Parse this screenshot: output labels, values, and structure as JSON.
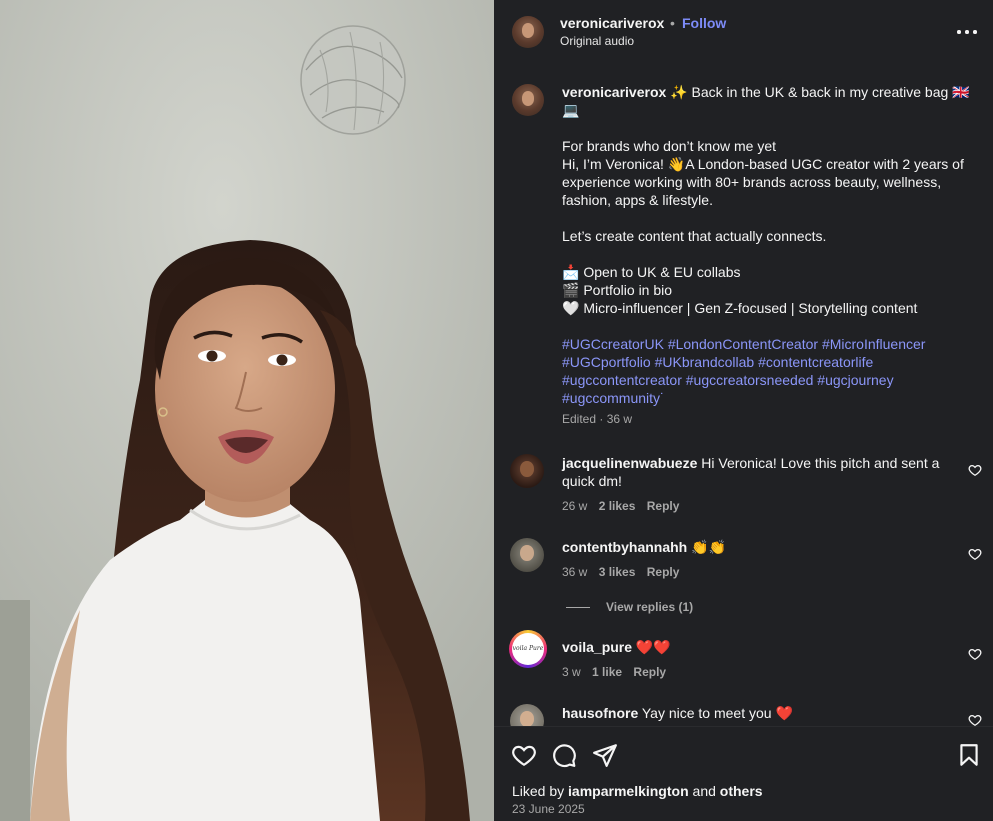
{
  "post": {
    "username": "veronicariverox",
    "dot": "•",
    "follow_label": "Follow",
    "audio": "Original audio"
  },
  "caption": {
    "username": "veronicariverox",
    "line1": " ✨ Back in the UK & back in my creative bag 🇬🇧💻",
    "line2": "For brands who don’t know me yet",
    "line3": "Hi, I’m Veronica! 👋A London-based UGC creator with 2 years of experience working with 80+ brands across beauty, wellness, fashion, apps & lifestyle.",
    "line4": "Let’s create content that actually connects.",
    "line5": "📩 Open to UK & EU collabs",
    "line6": "🎬 Portfolio in bio",
    "line7": "🤍 Micro-influencer | Gen Z-focused | Storytelling content",
    "hashtags": [
      "#UGCcreatorUK",
      "#LondonContentCreator",
      "#MicroInfluencer",
      "#UGCportfolio",
      "#UKbrandcollab",
      "#contentcreatorlife",
      "#ugccontentcreator",
      "#ugccreatorsneeded",
      "#ugcjourney",
      "#ugccommunity"
    ],
    "hashtag_suffix": "˙",
    "meta": "Edited · 36 w"
  },
  "comments": [
    {
      "username": "jacquelinenwabueze",
      "text": " Hi Veronica! Love this pitch and sent a quick dm!",
      "age": "26 w",
      "likes": "2 likes",
      "reply": "Reply"
    },
    {
      "username": "contentbyhannahh",
      "text": " 👏👏",
      "age": "36 w",
      "likes": "3 likes",
      "reply": "Reply",
      "view_replies": "View replies (1)"
    },
    {
      "username": "voila_pure",
      "text": " ❤️❤️",
      "age": "3 w",
      "likes": "1 like",
      "reply": "Reply",
      "avatar_text": "voila Pure"
    },
    {
      "username": "hausofnore",
      "text": " Yay nice to meet you ❤️"
    }
  ],
  "footer": {
    "liked_prefix": "Liked by ",
    "liked_user": "iamparmelkington",
    "liked_and": " and ",
    "liked_others": "others",
    "date": "23 June 2025"
  },
  "icons": [
    "more-icon",
    "heart-icon",
    "comment-icon",
    "share-icon",
    "bookmark-icon"
  ],
  "colors": {
    "panel": "#202124",
    "link": "#7d8bf7",
    "hashtag": "#8b96f8",
    "muted": "#a8a8a8"
  }
}
